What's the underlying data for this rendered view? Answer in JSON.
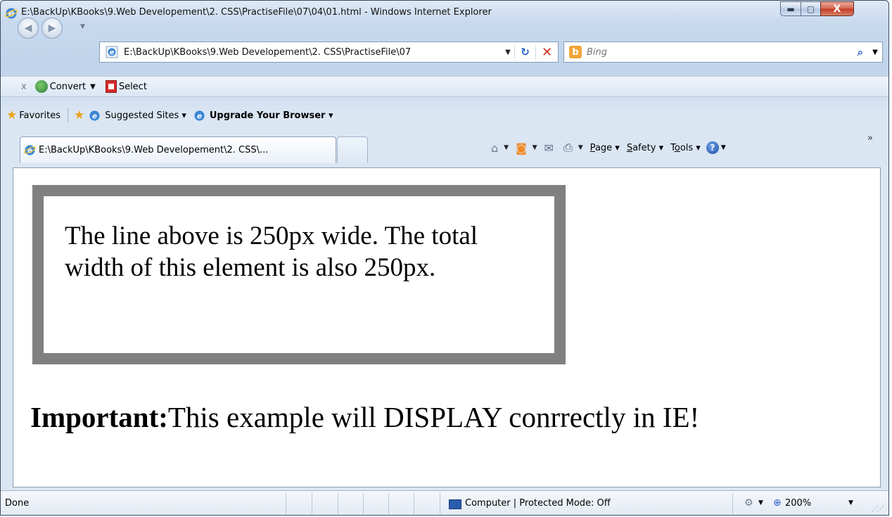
{
  "window": {
    "title": "E:\\BackUp\\KBooks\\9.Web Developement\\2. CSS\\PractiseFile\\07\\04\\01.html - Windows Internet Explorer",
    "minimize_glyph": "▬",
    "maximize_glyph": "▢",
    "close_glyph": "X"
  },
  "nav": {
    "address": "E:\\BackUp\\KBooks\\9.Web Developement\\2. CSS\\PractiseFile\\07",
    "search_placeholder": "Bing"
  },
  "command_toolbar": {
    "close_glyph": "x",
    "convert_label": "Convert",
    "select_label": "Select"
  },
  "favorites_bar": {
    "favorites_label": "Favorites",
    "suggested_sites_label": "Suggested Sites ▾",
    "upgrade_label": "Upgrade Your Browser ▾"
  },
  "tabs": {
    "active_label": "E:\\BackUp\\KBooks\\9.Web Developement\\2. CSS\\..."
  },
  "command_bar": {
    "page_prefix": "P",
    "page_rest": "age",
    "safety_prefix": "S",
    "safety_rest": "afety",
    "tools_prefix": "T",
    "tools_underlined": "o",
    "tools_rest": "ols",
    "help_glyph": "?",
    "more_glyph": "»"
  },
  "page": {
    "box_text": "The line above is 250px wide. The total width of this element is also 250px.",
    "important_label": "Important:",
    "important_text": "This example will DISPLAY conrrectly in IE!"
  },
  "statusbar": {
    "status": "Done",
    "zone": "Computer | Protected Mode: Off",
    "zoom": "200%"
  },
  "icons": {
    "ie_logo": "ie-logo-icon",
    "back": "back-arrow-icon",
    "forward": "forward-arrow-icon",
    "refresh": "refresh-icon",
    "stop": "stop-icon",
    "bing": "bing-icon",
    "search": "search-icon",
    "home": "home-icon",
    "feeds": "feeds-icon",
    "mail": "mail-icon",
    "print": "print-icon",
    "help": "help-icon"
  },
  "colors": {
    "box_border": "#808080",
    "stop_red": "#cc2a1e",
    "bing_orange": "#f2a53a"
  }
}
